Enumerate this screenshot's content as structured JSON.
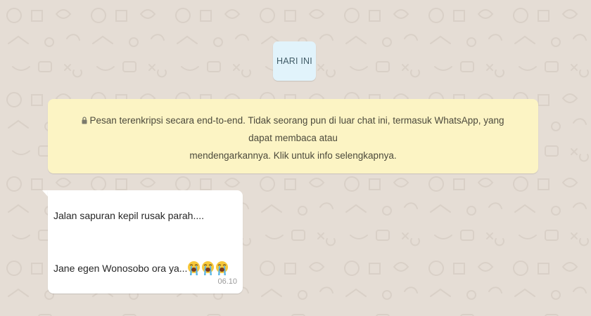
{
  "date_divider": {
    "label": "HARI INI"
  },
  "encryption_notice": {
    "icon": "lock-icon",
    "line1": "Pesan terenkripsi secara end-to-end. Tidak seorang pun di luar chat ini, termasuk WhatsApp, yang dapat membaca atau",
    "line2": "mendengarkannya. Klik untuk info selengkapnya."
  },
  "message": {
    "line1": "Jalan sapuran kepil rusak parah....",
    "line2": "Jane egen Wonosobo ora ya...",
    "emojis": [
      "loudly-crying-face-icon",
      "loudly-crying-face-icon",
      "loudly-crying-face-icon"
    ],
    "time": "06.10"
  },
  "colors": {
    "wallpaper": "#e5ddd5",
    "date_chip": "#e1f3fb",
    "notice": "#fcf4c4",
    "bubble": "#ffffff"
  }
}
